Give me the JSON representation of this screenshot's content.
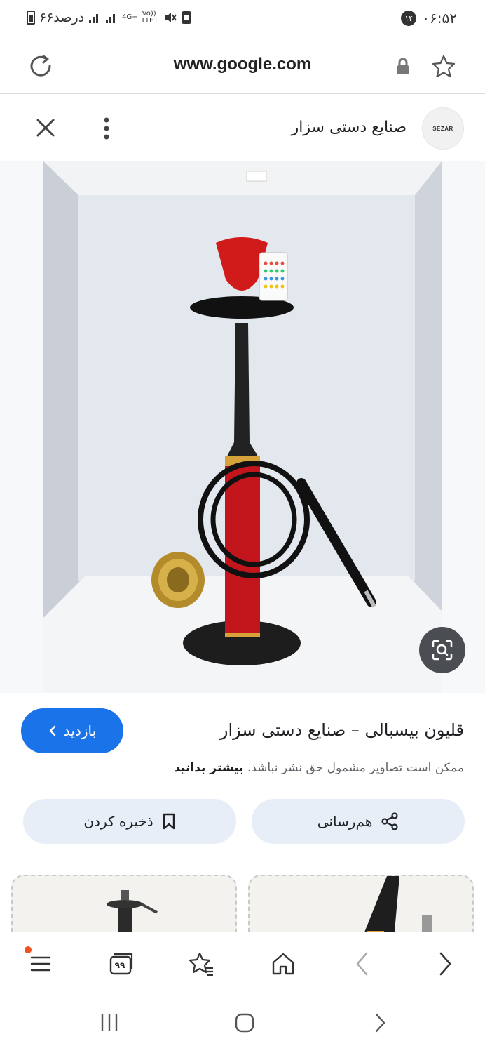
{
  "status_bar": {
    "time": "۰۶:۵۲",
    "notification_count": "۱۴",
    "battery_text": "۶۶درصد",
    "network_label": "4G+",
    "volte_label": "Vo))",
    "lte_label": "LTE1"
  },
  "address_bar": {
    "url": "www.google.com"
  },
  "source": {
    "name": "صنایع دستی سزار",
    "logo_text": "SEZAR"
  },
  "result": {
    "title": "قلیون بیسبالی – صنایع دستی سزار",
    "visit_label": "بازدید",
    "copyright_notice": "ممکن است تصاویر مشمول حق نشر نباشد.",
    "learn_more": "بیشتر بدانید",
    "save_label": "ذخیره کردن",
    "share_label": "هم‌رسانی"
  },
  "bottom_nav": {
    "tabs_count": "۹۹"
  },
  "colors": {
    "accent": "#1a73e8",
    "chip_bg": "#e8eef8",
    "menu_badge": "#f4511e"
  }
}
